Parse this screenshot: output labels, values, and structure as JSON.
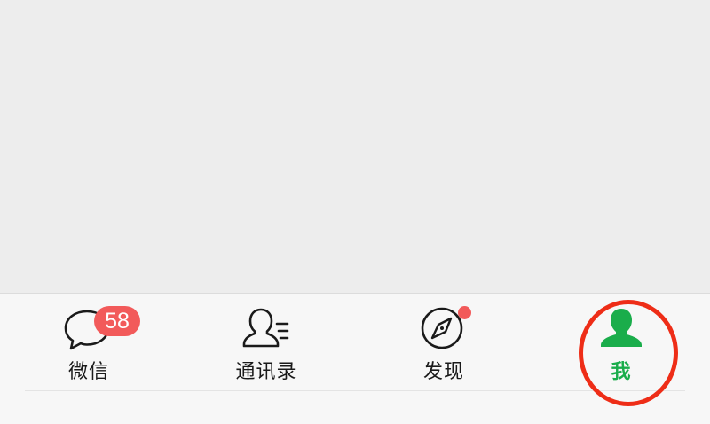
{
  "tabbar": {
    "tabs": [
      {
        "id": "chats",
        "label": "微信",
        "icon": "chat-bubble-icon",
        "badge": "58"
      },
      {
        "id": "contacts",
        "label": "通讯录",
        "icon": "contacts-icon"
      },
      {
        "id": "discover",
        "label": "发现",
        "icon": "compass-icon",
        "dot": true
      },
      {
        "id": "me",
        "label": "我",
        "icon": "person-icon",
        "active": true
      }
    ]
  },
  "colors": {
    "active": "#1aad4b",
    "badge": "#f25a5a",
    "annotation": "#ee2d17"
  }
}
